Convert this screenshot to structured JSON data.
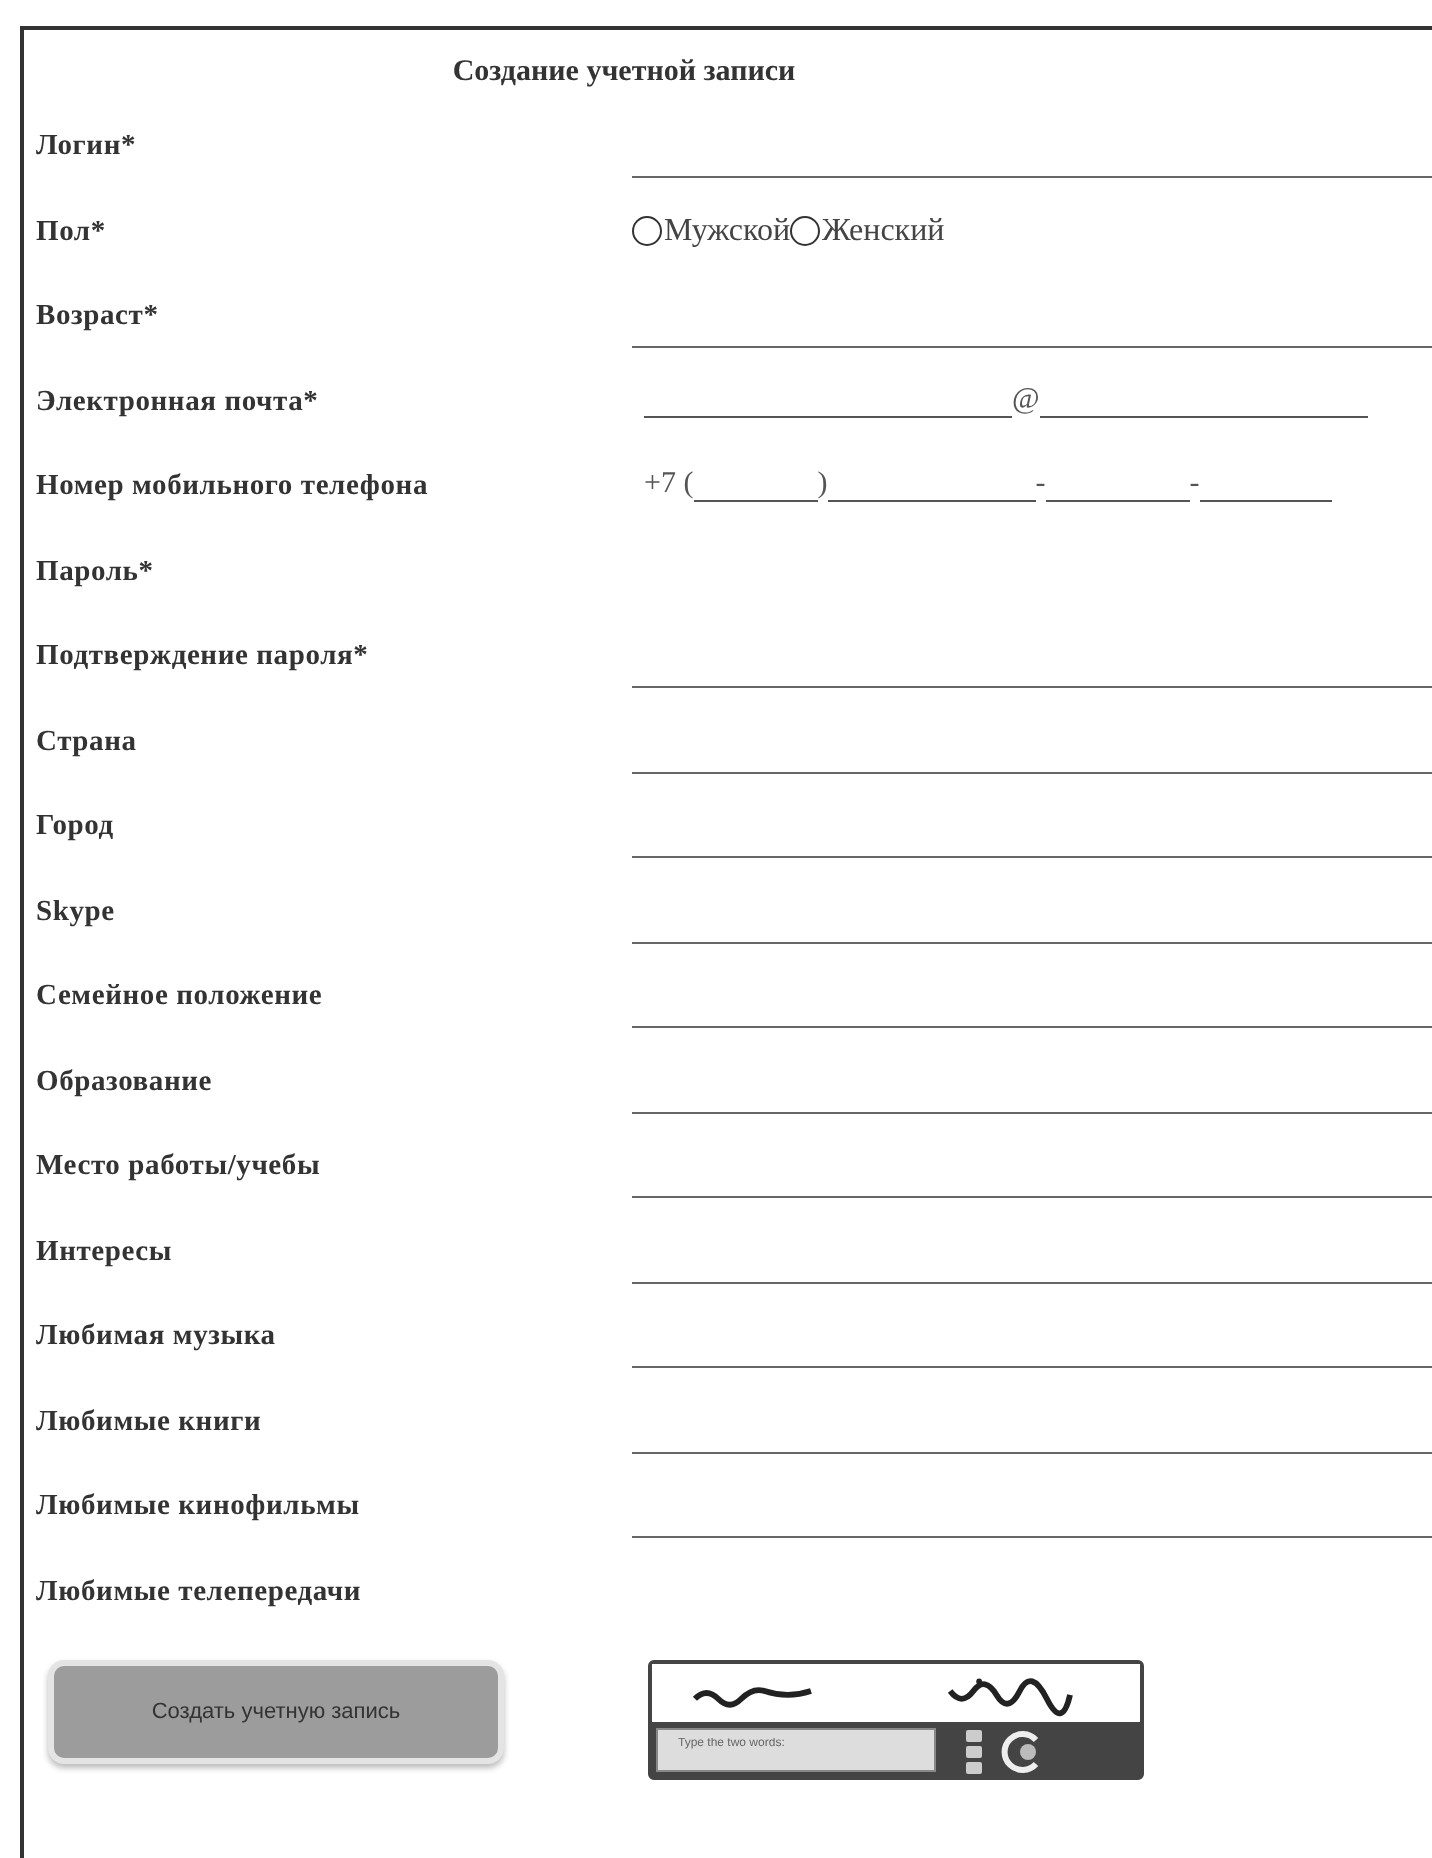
{
  "title": "Создание учетной записи",
  "fields": [
    {
      "label": "Логин*",
      "kind": "text"
    },
    {
      "label": "Пол*",
      "kind": "radio",
      "options": [
        {
          "label": "Мужской",
          "selected": false
        },
        {
          "label": "Женский",
          "selected": false
        }
      ]
    },
    {
      "label": "Возраст*",
      "kind": "text"
    },
    {
      "label": "Электронная почта*",
      "kind": "email",
      "separator": "@"
    },
    {
      "label": "Номер мобильного телефона",
      "kind": "phone",
      "segments": [
        "+7 (",
        ")",
        "-",
        "-"
      ]
    },
    {
      "label": "Пароль*",
      "kind": "blank"
    },
    {
      "label": "Подтверждение пароля*",
      "kind": "text"
    },
    {
      "label": "Страна",
      "kind": "text"
    },
    {
      "label": "Город",
      "kind": "text"
    },
    {
      "label": "Skype",
      "kind": "text"
    },
    {
      "label": "Семейное положение",
      "kind": "text"
    },
    {
      "label": "Образование",
      "kind": "text"
    },
    {
      "label": "Место работы/учебы",
      "kind": "text"
    },
    {
      "label": "Интересы",
      "kind": "text"
    },
    {
      "label": "Любимая музыка",
      "kind": "text"
    },
    {
      "label": "Любимые книги",
      "kind": "text"
    },
    {
      "label": "Любимые кинофильмы",
      "kind": "text"
    },
    {
      "label": "Любимые телепередачи",
      "kind": "blank"
    }
  ],
  "submit_button": "Создать учетную запись",
  "captcha": {
    "kind": "picture",
    "placeholder": "Type the two words:"
  }
}
